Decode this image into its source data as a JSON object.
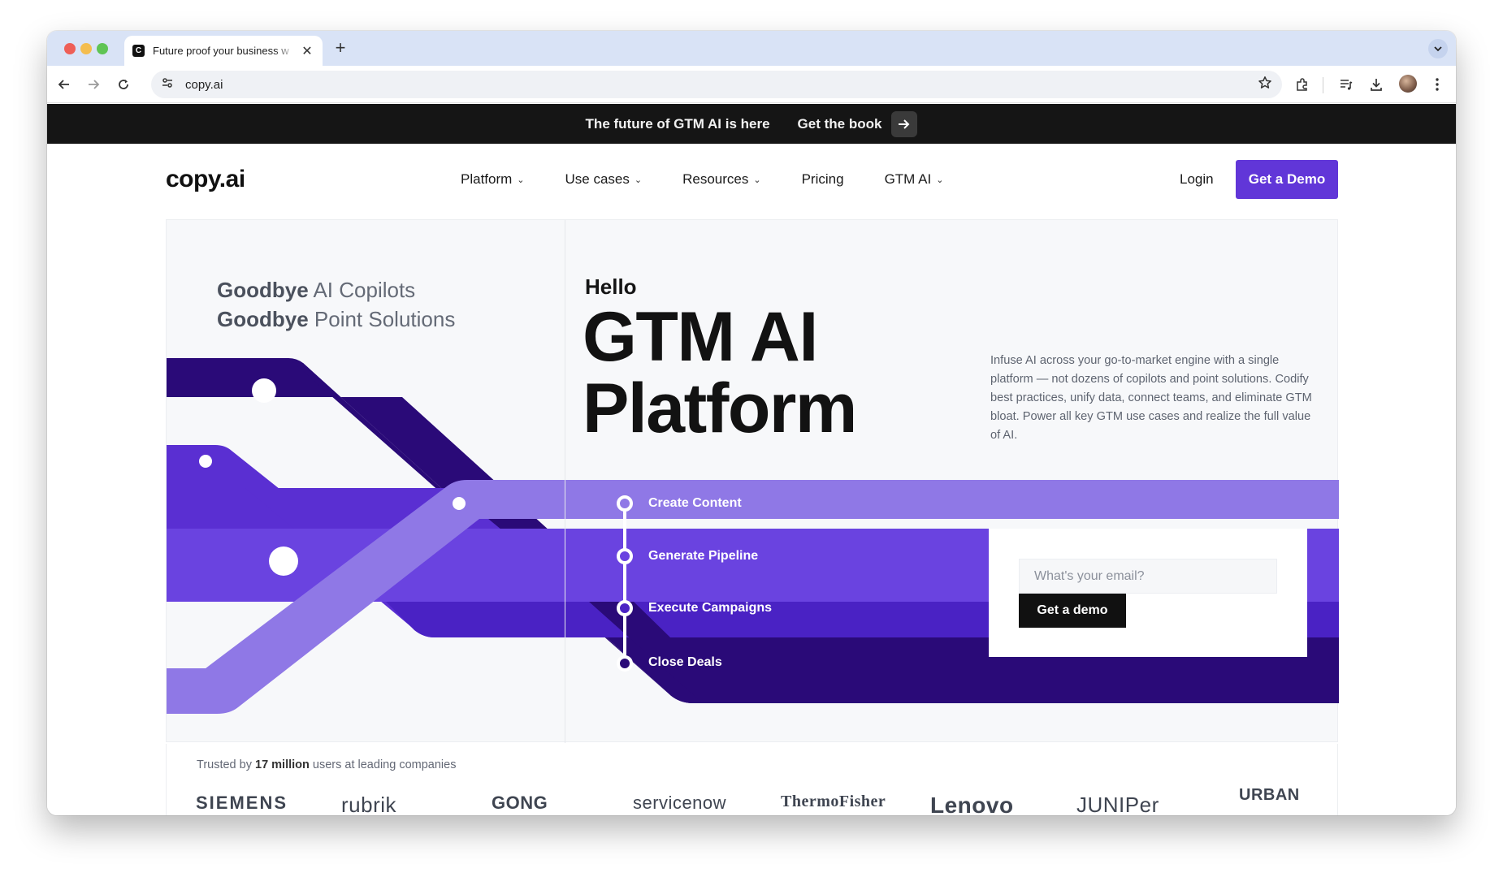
{
  "browser": {
    "tab_title": "Future proof your business w",
    "tab_favicon": "C",
    "url": "copy.ai"
  },
  "announcement": {
    "text": "The future of GTM AI is here",
    "cta": "Get the book"
  },
  "nav": {
    "logo": "copy.ai",
    "items": [
      {
        "label": "Platform",
        "dropdown": true
      },
      {
        "label": "Use cases",
        "dropdown": true
      },
      {
        "label": "Resources",
        "dropdown": true
      },
      {
        "label": "Pricing",
        "dropdown": false
      },
      {
        "label": "GTM AI",
        "dropdown": true
      }
    ],
    "login": "Login",
    "demo_button": "Get a Demo"
  },
  "hero": {
    "goodbye_1_bold": "Goodbye",
    "goodbye_1_rest": " AI Copilots",
    "goodbye_2_bold": "Goodbye",
    "goodbye_2_rest": " Point Solutions",
    "hello": "Hello",
    "headline_1": "GTM AI",
    "headline_2": "Platform",
    "description": "Infuse AI across your go-to-market engine with a single platform — not dozens of copilots and point solutions. Codify best practices, unify data, connect teams, and eliminate GTM bloat. Power all key GTM use cases and realize the full value of AI.",
    "steps": [
      "Create Content",
      "Generate Pipeline",
      "Execute Campaigns",
      "Close Deals"
    ],
    "email_placeholder": "What's your email?",
    "form_button": "Get a demo"
  },
  "trusted": {
    "prefix": "Trusted by ",
    "count": "17 million",
    "suffix": " users at leading companies",
    "logos": [
      "SIEMENS",
      "rubrik",
      "GONG",
      "servicenow",
      "ThermoFisher",
      "Lenovo",
      "JUNIPer",
      "URBAN"
    ]
  },
  "colors": {
    "accent": "#6136d8",
    "purple_dark": "#2a0a78",
    "purple_mid": "#5a2fd2",
    "purple_bright": "#6a43e0",
    "purple_light": "#8f78e6"
  }
}
